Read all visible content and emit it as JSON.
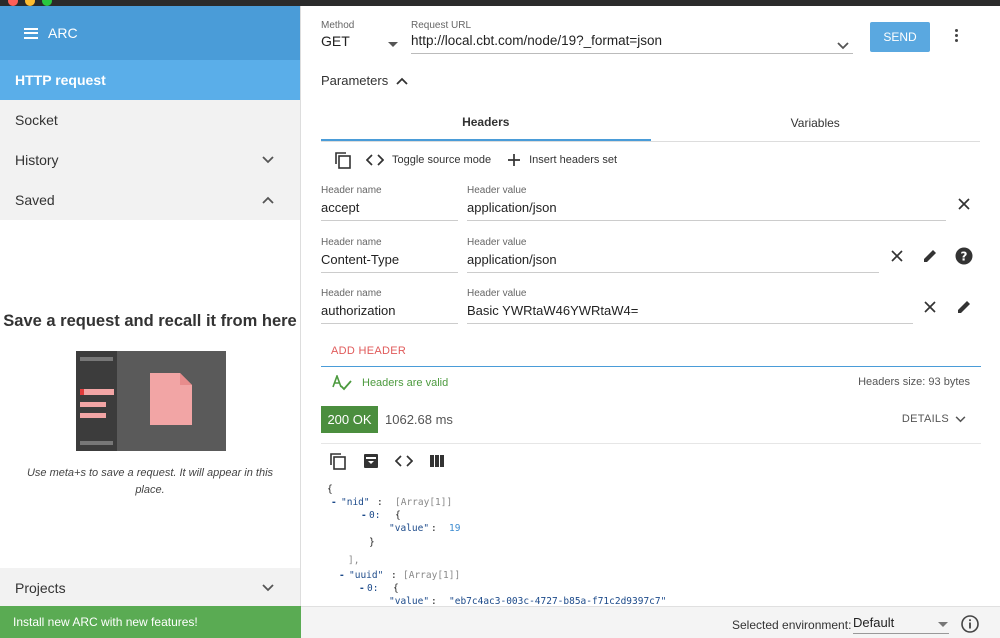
{
  "sidebar": {
    "title": "ARC",
    "items": [
      {
        "label": "HTTP request"
      },
      {
        "label": "Socket"
      },
      {
        "label": "History"
      },
      {
        "label": "Saved"
      }
    ],
    "saved": {
      "title": "Save a request and recall it from here",
      "hint": "Use meta+s to save a request. It will appear in this place."
    },
    "projects_label": "Projects",
    "update_banner": "Install new ARC with new features!"
  },
  "request": {
    "method_label": "Method",
    "method": "GET",
    "url_label": "Request URL",
    "url": "http://local.cbt.com/node/19?_format=json",
    "send_label": "SEND"
  },
  "parameters_label": "Parameters",
  "tabs": [
    {
      "label": "Headers"
    },
    {
      "label": "Variables"
    }
  ],
  "toolbar": {
    "toggle_label": "Toggle source mode",
    "insert_label": "Insert headers set"
  },
  "headers": [
    {
      "name_label": "Header name",
      "name": "accept",
      "value_label": "Header value",
      "value": "application/json"
    },
    {
      "name_label": "Header name",
      "name": "Content-Type",
      "value_label": "Header value",
      "value": "application/json"
    },
    {
      "name_label": "Header name",
      "name": "authorization",
      "value_label": "Header value",
      "value": "Basic YWRtaW46YWRtaW4="
    }
  ],
  "add_header_label": "ADD HEADER",
  "validation": {
    "text": "Headers are valid",
    "size": "Headers size: 93 bytes"
  },
  "response": {
    "status": "200 OK",
    "time": "1062.68 ms",
    "details_label": "DETAILS",
    "json": {
      "open_brace": "{",
      "nid_key": "\"nid\"",
      "nid_meta": "Array[1]",
      "idx0": "0:",
      "inner_open": "{",
      "value_key": "\"value\"",
      "nid_value": "19",
      "inner_close": "}",
      "arr_close": "],",
      "uuid_key": "\"uuid\"",
      "uuid_meta": "Array[1]",
      "uuid_value": "\"eb7c4ac3-003c-4727-b85a-f71c2d9397c7\""
    }
  },
  "environment": {
    "label": "Selected environment:",
    "value": "Default"
  },
  "colors": {
    "sidebar_header": "#4a9cd8",
    "active_item": "#5aaee9",
    "send": "#5aa8e0",
    "status_ok": "#4b8e3e",
    "banner": "#5aab53",
    "add_header": "#e05a5a"
  }
}
